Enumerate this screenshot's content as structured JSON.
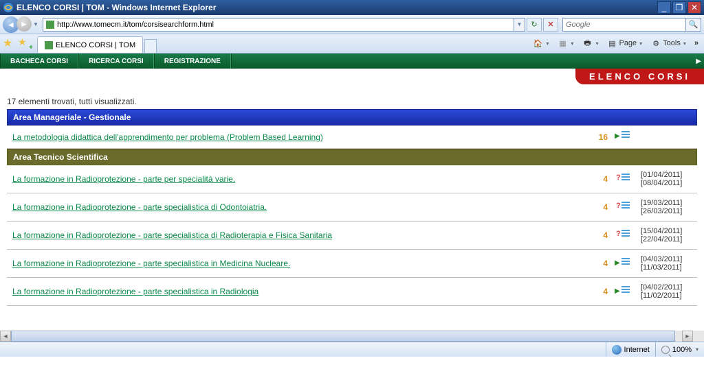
{
  "window": {
    "title": "ELENCO CORSI | TOM - Windows Internet Explorer"
  },
  "nav": {
    "url": "http://www.tomecm.it/tom/corsisearchform.html",
    "search_placeholder": "Google"
  },
  "tabs": {
    "active": "ELENCO CORSI | TOM"
  },
  "toolbar": {
    "page_label": "Page",
    "tools_label": "Tools"
  },
  "menu": {
    "items": [
      "BACHECA CORSI",
      "RICERCA CORSI",
      "REGISTRAZIONE"
    ]
  },
  "page": {
    "banner": "ELENCO CORSI",
    "result_count": "17 elementi trovati, tutti visualizzati."
  },
  "sections": [
    {
      "title": "Area Manageriale - Gestionale",
      "style": "blue",
      "courses": [
        {
          "title": "La metodologia didattica dell'apprendimento per problema (Problem Based Learning)",
          "num": "16",
          "icon": "arrow",
          "dates": []
        }
      ]
    },
    {
      "title": "Area Tecnico Scientifica",
      "style": "olive",
      "courses": [
        {
          "title": "La formazione in Radioprotezione - parte per specialità varie.",
          "num": "4",
          "icon": "q",
          "dates": [
            "[01/04/2011]",
            "[08/04/2011]"
          ]
        },
        {
          "title": "La formazione in Radioprotezione - parte specialistica di Odontoiatria.",
          "num": "4",
          "icon": "q",
          "dates": [
            "[19/03/2011]",
            "[26/03/2011]"
          ]
        },
        {
          "title": "La formazione in Radioprotezione - parte specialistica di Radioterapia e Fisica Sanitaria",
          "num": "4",
          "icon": "q",
          "dates": [
            "[15/04/2011]",
            "[22/04/2011]"
          ]
        },
        {
          "title": "La formazione in Radioprotezione - parte specialistica in Medicina Nucleare.",
          "num": "4",
          "icon": "arrow",
          "dates": [
            "[04/03/2011]",
            "[11/03/2011]"
          ]
        },
        {
          "title": "La formazione in Radioprotezione - parte specialistica in Radiologia",
          "num": "4",
          "icon": "arrow",
          "dates": [
            "[04/02/2011]",
            "[11/02/2011]"
          ]
        }
      ]
    }
  ],
  "status": {
    "zone": "Internet",
    "zoom": "100%"
  }
}
